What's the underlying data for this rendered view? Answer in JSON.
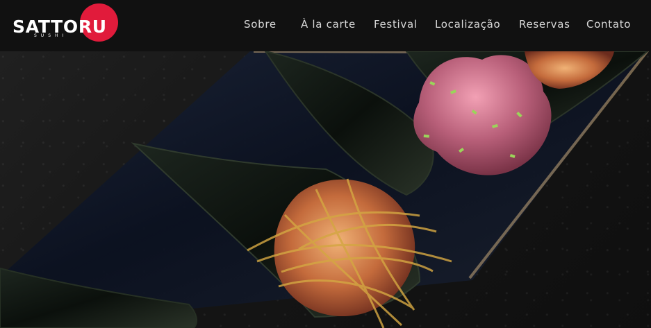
{
  "brand": {
    "name": "SATTORU",
    "subtitle": "SUSHI",
    "accent": "#e11b3b"
  },
  "navigation": {
    "items": [
      {
        "label": "Sobre"
      },
      {
        "label": "À la carte"
      },
      {
        "label": "Festival"
      },
      {
        "label": "Localização"
      },
      {
        "label": "Reservas"
      },
      {
        "label": "Contato"
      }
    ]
  },
  "hero": {
    "image_content": "temaki-rolls-on-plate"
  },
  "colors": {
    "header_background": "#111111",
    "page_background": "#121212",
    "text": "#d9d9d9",
    "brand_accent": "#e11b3b"
  }
}
